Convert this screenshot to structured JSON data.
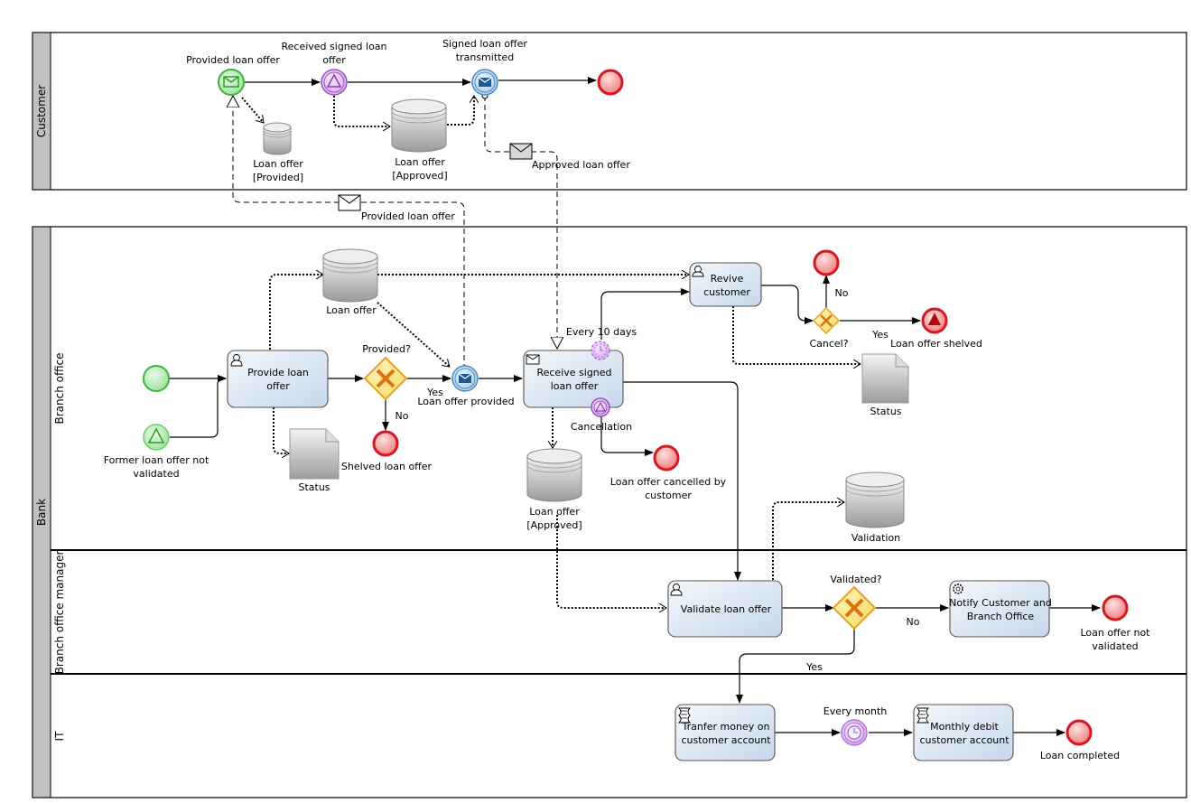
{
  "pools": [
    {
      "name": "Customer",
      "lanes": []
    },
    {
      "name": "Bank",
      "lanes": [
        {
          "name": "Branch office"
        },
        {
          "name": "Branch office manager"
        },
        {
          "name": "IT"
        }
      ]
    }
  ],
  "customer": {
    "start_msg_event": "Provided loan offer",
    "signal_catch_event": "Received signed loan offer",
    "send_msg_event": "Signed loan offer transmitted",
    "data_provided": "Loan offer [Provided]",
    "data_approved": "Loan offer [Approved]",
    "data_provided_l1": "Loan offer",
    "data_provided_l2": "[Provided]",
    "data_approved_l1": "Loan offer",
    "data_approved_l2": "[Approved]",
    "received_l1": "Received signed loan",
    "received_l2": "offer",
    "signed_l1": "Signed loan offer",
    "signed_l2": "transmitted"
  },
  "messages": {
    "approved": "Approved loan offer",
    "provided": "Provided loan offer"
  },
  "branch_office": {
    "former_l1": "Former loan offer not",
    "former_l2": "validated",
    "task_provide_l1": "Provide loan",
    "task_provide_l2": "offer",
    "data_loan_offer": "Loan offer",
    "doc_status_1": "Status",
    "gateway_provided": "Provided?",
    "yes": "Yes",
    "no": "No",
    "end_shelved": "Shelved loan offer",
    "event_provided": "Loan offer provided",
    "task_receive_l1": "Receive signed",
    "task_receive_l2": "loan offer",
    "timer_boundary": "Every 10 days",
    "signal_boundary": "Cancellation",
    "end_cancelled_l1": "Loan offer cancelled by",
    "end_cancelled_l2": "customer",
    "data_approved_l1": "Loan offer",
    "data_approved_l2": "[Approved]",
    "task_revive_l1": "Revive",
    "task_revive_l2": "customer",
    "gateway_cancel": "Cancel?",
    "end_offer_shelved": "Loan offer shelved",
    "doc_status_2": "Status",
    "data_validation": "Validation"
  },
  "manager": {
    "task_validate": "Validate loan offer",
    "gateway_validated": "Validated?",
    "no": "No",
    "yes": "Yes",
    "task_notify_l1": "Notify Customer and",
    "task_notify_l2": "Branch Office",
    "end_not_validated_l1": "Loan offer not",
    "end_not_validated_l2": "validated"
  },
  "it": {
    "task_transfer_l1": "Tranfer money on",
    "task_transfer_l2": "customer account",
    "timer_event": "Every month",
    "task_debit_l1": "Monthly debit",
    "task_debit_l2": "customer account",
    "end_completed": "Loan completed"
  },
  "colors": {
    "start_green": "#4cc04c",
    "end_red": "#d8131b",
    "signal_purple": "#a055c8",
    "message_blue": "#2e6fb0",
    "gateway_orange": "#e08a00",
    "task_fill_top": "#f3f7fb",
    "task_fill_bottom": "#c7d9ea"
  }
}
